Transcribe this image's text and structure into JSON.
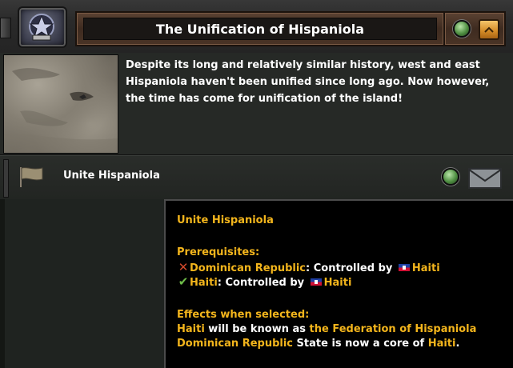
{
  "header": {
    "title": "The Unification of Hispaniola",
    "emblem_icon": "decision-category-emblem-icon",
    "status_icon": "green-status-icon",
    "collapse_icon": "chevron-up-icon"
  },
  "description": {
    "image_icon": "caribbean-map-picture",
    "text": "Despite its long and relatively similar history, west and east Hispaniola haven't been unified since long ago. Now however, the time has come for unification of the island!"
  },
  "decision": {
    "name": "Unite Hispaniola",
    "flag_icon": "flag-icon",
    "status_icon": "green-status-icon",
    "envelope_icon": "envelope-icon"
  },
  "tooltip": {
    "title": "Unite Hispaniola",
    "prerequisites_label": "Prerequisites:",
    "prereqs": [
      {
        "met": false,
        "subject": "Dominican Republic",
        "text": ": Controlled by ",
        "target": "Haiti"
      },
      {
        "met": true,
        "subject": "Haiti",
        "text": ": Controlled by ",
        "target": "Haiti"
      }
    ],
    "effects_label": "Effects when selected:",
    "effect1": {
      "subject": "Haiti",
      "text": " will be known as ",
      "target": "the Federation of Hispaniola"
    },
    "effect2": {
      "subject": "Dominican Republic",
      "text": " State is now a core of ",
      "target": "Haiti",
      "end": "."
    }
  },
  "colors": {
    "accent_gold": "#f3b51c",
    "fail_red": "#d2482a",
    "ok_green": "#6fbe49",
    "panel_bg": "#262926",
    "tooltip_bg": "#000000"
  }
}
